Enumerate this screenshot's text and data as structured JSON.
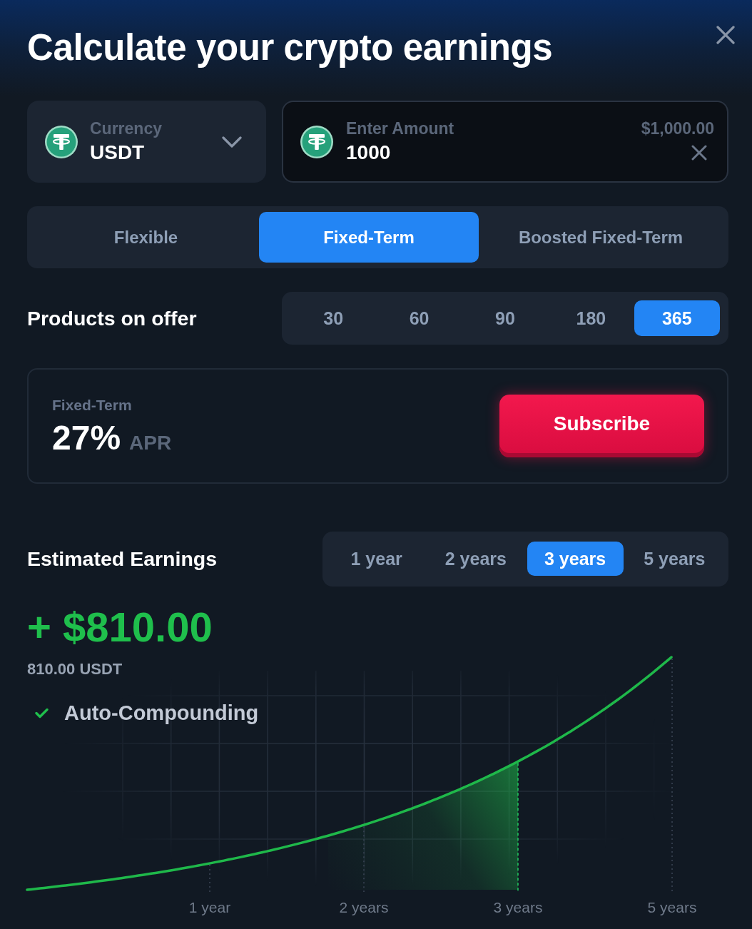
{
  "title": "Calculate your crypto earnings",
  "currency": {
    "label": "Currency",
    "value": "USDT"
  },
  "amount": {
    "label": "Enter Amount",
    "value": "1000",
    "converted": "$1,000.00"
  },
  "earning_types": [
    {
      "label": "Flexible",
      "selected": false
    },
    {
      "label": "Fixed-Term",
      "selected": true
    },
    {
      "label": "Boosted Fixed-Term",
      "selected": false
    }
  ],
  "products": {
    "label": "Products on offer",
    "durations": [
      {
        "label": "30",
        "selected": false
      },
      {
        "label": "60",
        "selected": false
      },
      {
        "label": "90",
        "selected": false
      },
      {
        "label": "180",
        "selected": false
      },
      {
        "label": "365",
        "selected": true
      }
    ]
  },
  "offer": {
    "type": "Fixed-Term",
    "rate": "27%",
    "rate_unit": "APR",
    "action": "Subscribe"
  },
  "estimate": {
    "label": "Estimated Earnings",
    "periods": [
      {
        "label": "1 year",
        "selected": false
      },
      {
        "label": "2 years",
        "selected": false
      },
      {
        "label": "3 years",
        "selected": true
      },
      {
        "label": "5 years",
        "selected": false
      }
    ],
    "amount": "+ $810.00",
    "amount_usdt": "810.00 USDT",
    "auto_compounding": {
      "label": "Auto-Compounding",
      "checked": true
    }
  },
  "chart": {
    "x_labels": [
      "1 year",
      "2 years",
      "3 years",
      "5 years"
    ]
  }
}
